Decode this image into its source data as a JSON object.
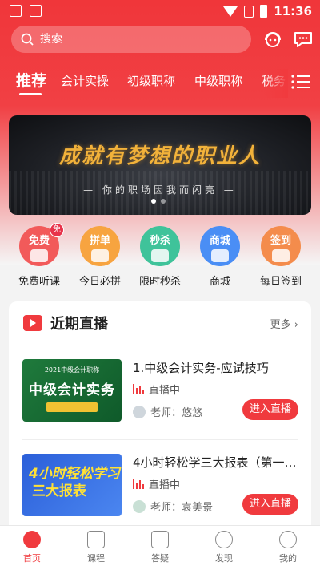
{
  "status_bar": {
    "time": "11:36"
  },
  "search": {
    "placeholder": "搜索"
  },
  "tabs": [
    {
      "label": "推荐",
      "active": true
    },
    {
      "label": "会计实操"
    },
    {
      "label": "初级职称"
    },
    {
      "label": "中级职称"
    },
    {
      "label": "税务"
    }
  ],
  "banner": {
    "title": "成就有梦想的职业人",
    "subtitle": "— 你的职场因我而闪亮 —",
    "pages": 2,
    "current": 1
  },
  "quick_entries": [
    {
      "badge_text": "免费",
      "label": "免费听课",
      "color": "#f25a5a",
      "extra_badge": "免",
      "icon": "play-icon"
    },
    {
      "badge_text": "拼单",
      "label": "今日必拼",
      "color": "#f7a440",
      "icon": "tag-icon"
    },
    {
      "badge_text": "秒杀",
      "label": "限时秒杀",
      "color": "#3fc39a",
      "icon": "lightning-icon"
    },
    {
      "badge_text": "商城",
      "label": "商城",
      "color": "#4a8ef5",
      "icon": "shopping-bag-icon"
    },
    {
      "badge_text": "签到",
      "label": "每日签到",
      "color": "#f48c4c",
      "icon": "calendar-icon"
    }
  ],
  "live": {
    "title": "近期直播",
    "more": "更多 ›",
    "courses": [
      {
        "title": "1.中级会计实务-应试技巧",
        "status": "直播中",
        "teacher": "老师：悠悠",
        "button": "进入直播",
        "thumb_top": "2021中级会计职称",
        "thumb_main": "中级会计实务"
      },
      {
        "title": "4小时轻松学三大报表（第一…",
        "status": "直播中",
        "teacher": "老师：袁美景",
        "button": "进入直播",
        "thumb_line1": "4小时轻松学习",
        "thumb_line2": "三大报表"
      }
    ]
  },
  "bottom_nav": [
    {
      "label": "首页",
      "active": true,
      "icon": "home-icon"
    },
    {
      "label": "课程",
      "icon": "book-icon"
    },
    {
      "label": "答疑",
      "icon": "chat-icon"
    },
    {
      "label": "发现",
      "icon": "planet-icon"
    },
    {
      "label": "我的",
      "icon": "user-icon"
    }
  ],
  "colors": {
    "brand_red": "#f03a3e",
    "gold": "#f2b23a"
  }
}
